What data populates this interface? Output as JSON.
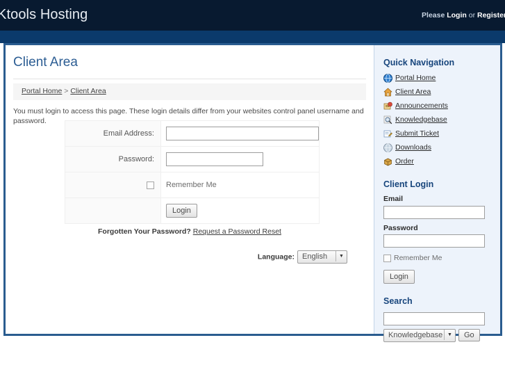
{
  "header": {
    "site_title": "Ktools Hosting",
    "prompt_prefix": "Please ",
    "login_label": "Login",
    "prompt_sep": " or ",
    "register_label": "Register"
  },
  "main": {
    "page_title": "Client Area",
    "breadcrumb": {
      "home": "Portal Home",
      "separator": ">",
      "current": "Client Area"
    },
    "intro": "You must login to access this page. These login details differ from your websites control panel username and password.",
    "form": {
      "email_label": "Email Address:",
      "email_value": "",
      "password_label": "Password:",
      "password_value": "",
      "remember_label": "Remember Me",
      "login_button": "Login"
    },
    "forgot_prefix": "Forgotten Your Password?",
    "forgot_link": "Request a Password Reset",
    "language_label": "Language:",
    "language_value": "English"
  },
  "sidebar": {
    "quick_nav_title": "Quick Navigation",
    "quick_nav_items": [
      {
        "label": "Portal Home",
        "icon": "globe-icon"
      },
      {
        "label": "Client Area",
        "icon": "home-icon"
      },
      {
        "label": "Announcements",
        "icon": "announcement-icon"
      },
      {
        "label": "Knowledgebase",
        "icon": "magnifier-icon"
      },
      {
        "label": "Submit Ticket",
        "icon": "ticket-icon"
      },
      {
        "label": "Downloads",
        "icon": "download-globe-icon"
      },
      {
        "label": "Order",
        "icon": "package-icon"
      }
    ],
    "client_login_title": "Client Login",
    "email_label": "Email",
    "email_value": "",
    "password_label": "Password",
    "password_value": "",
    "remember_label": "Remember Me",
    "login_button": "Login",
    "search_title": "Search",
    "search_value": "",
    "search_scope": "Knowledgebase",
    "go_button": "Go"
  },
  "colors": {
    "topbar": "#081a30",
    "navband": "#0b3a6b",
    "container_border": "#2a5c8f",
    "sidebar_bg": "#edf3fb",
    "heading": "#2c5d93",
    "side_heading": "#17457c"
  }
}
